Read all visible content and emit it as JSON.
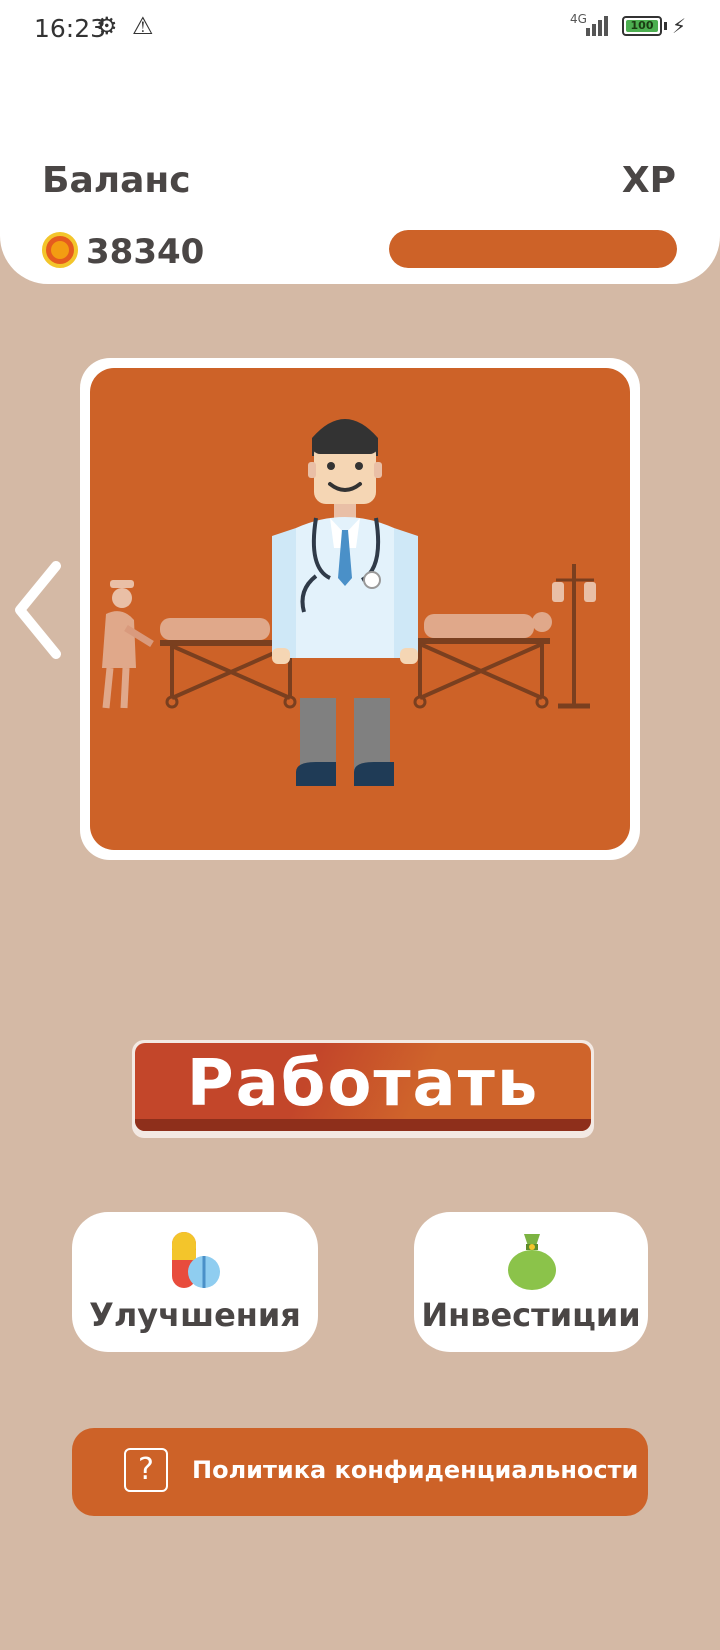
{
  "status_bar": {
    "time": "16:23",
    "network": "4G",
    "battery": "100"
  },
  "header": {
    "balance_title": "Баланс",
    "balance_value": "38340",
    "xp_title": "XP",
    "xp_progress": 1.0
  },
  "scene": {
    "icon": "doctor-hospital-illustration"
  },
  "actions": {
    "work_label": "Работать",
    "upgrades_label": "Улучшения",
    "investments_label": "Инвестиции",
    "privacy_label": "Политика конфиденциальности"
  },
  "colors": {
    "background": "#d4b9a5",
    "accent": "#cd6228",
    "button_dark": "#c3462a",
    "text_dark": "#4a4645"
  }
}
